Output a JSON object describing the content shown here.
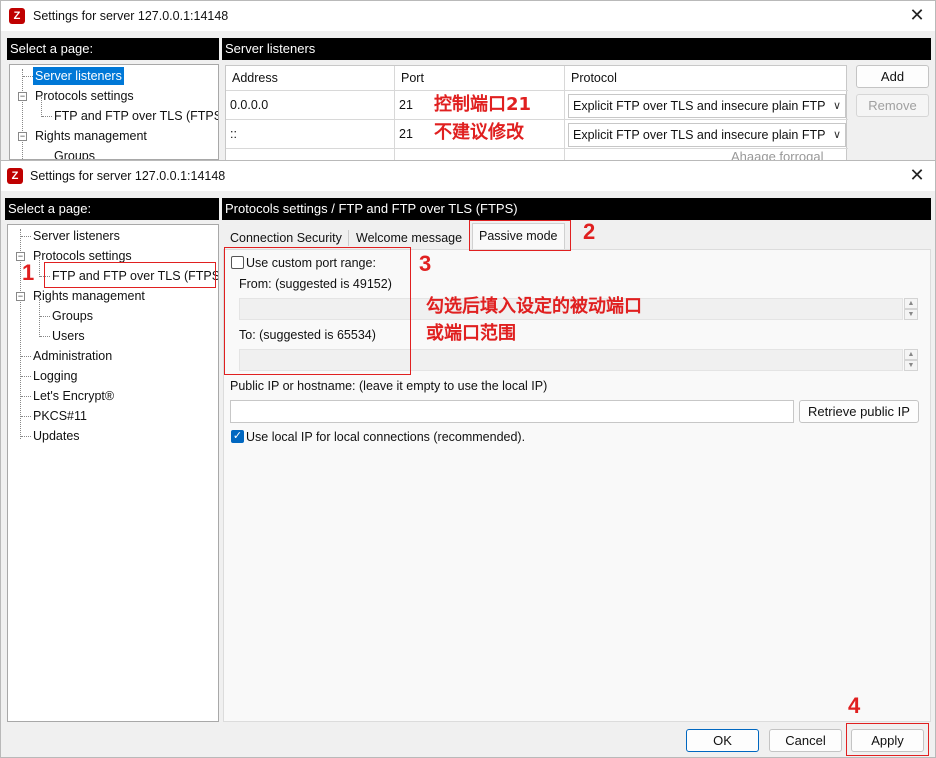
{
  "back_window": {
    "title": "Settings for server 127.0.0.1:14148",
    "select_page_label": "Select a page:",
    "panel_title": "Server listeners",
    "tree": [
      "Server listeners",
      "Protocols settings",
      "FTP and FTP over TLS (FTPS)",
      "Rights management",
      "Groups"
    ],
    "columns": [
      "Address",
      "Port",
      "Protocol"
    ],
    "rows": [
      {
        "address": "0.0.0.0",
        "port": "21",
        "protocol": "Explicit FTP over TLS and insecure plain FTP"
      },
      {
        "address": "::",
        "port": "21",
        "protocol": "Explicit FTP over TLS and insecure plain FTP"
      }
    ],
    "add_label": "Add",
    "remove_label": "Remove",
    "peek_text": "Ahaage forrogal"
  },
  "front_window": {
    "title": "Settings for server 127.0.0.1:14148",
    "select_page_label": "Select a page:",
    "panel_title": "Protocols settings / FTP and FTP over TLS (FTPS)",
    "tree": {
      "server_listeners": "Server listeners",
      "protocols_settings": "Protocols settings",
      "ftp_ftps": "FTP and FTP over TLS (FTPS)",
      "rights_management": "Rights management",
      "groups": "Groups",
      "users": "Users",
      "administration": "Administration",
      "logging": "Logging",
      "lets_encrypt": "Let's Encrypt®",
      "pkcs11": "PKCS#11",
      "updates": "Updates"
    },
    "tabs": [
      "Connection Security",
      "Welcome message",
      "Passive mode"
    ],
    "active_tab": "Passive mode",
    "use_custom_port_range": "Use custom port range:",
    "from_label": "From: (suggested is 49152)",
    "to_label": "To: (suggested is 65534)",
    "public_ip_label": "Public IP or hostname: (leave it empty to use the local IP)",
    "public_ip_value": "",
    "retrieve_label": "Retrieve public IP",
    "use_local_ip_label": "Use local IP for local connections (recommended).",
    "use_local_ip_checked": true,
    "custom_range_checked": false,
    "ok_label": "OK",
    "cancel_label": "Cancel",
    "apply_label": "Apply"
  },
  "annotations": {
    "n1": "1",
    "n2": "2",
    "n3": "3",
    "n4": "4",
    "note_port_line1": "控制端口21",
    "note_port_line2": "不建议修改",
    "note_passive_line1": "勾选后填入设定的被动端口",
    "note_passive_line2": "或端口范围"
  },
  "colors": {
    "annotation": "#e02020",
    "selection": "#0078d7",
    "header_bar": "#000000"
  }
}
